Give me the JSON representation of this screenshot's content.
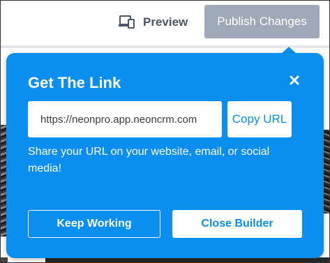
{
  "toolbar": {
    "preview_label": "Preview",
    "publish_label": "Publish Changes",
    "preview_icon": "devices-icon"
  },
  "popup": {
    "title": "Get The Link",
    "close_icon": "close-icon",
    "url_value": "https://neonpro.app.neoncrm.com",
    "copy_label": "Copy URL",
    "share_text": "Share your URL on your website, email, or social media!",
    "keep_working_label": "Keep Working",
    "close_builder_label": "Close Builder"
  },
  "colors": {
    "popup_bg": "#0a8ef0",
    "publish_bg": "#9fa8b7",
    "preview_text": "#4a5566"
  }
}
